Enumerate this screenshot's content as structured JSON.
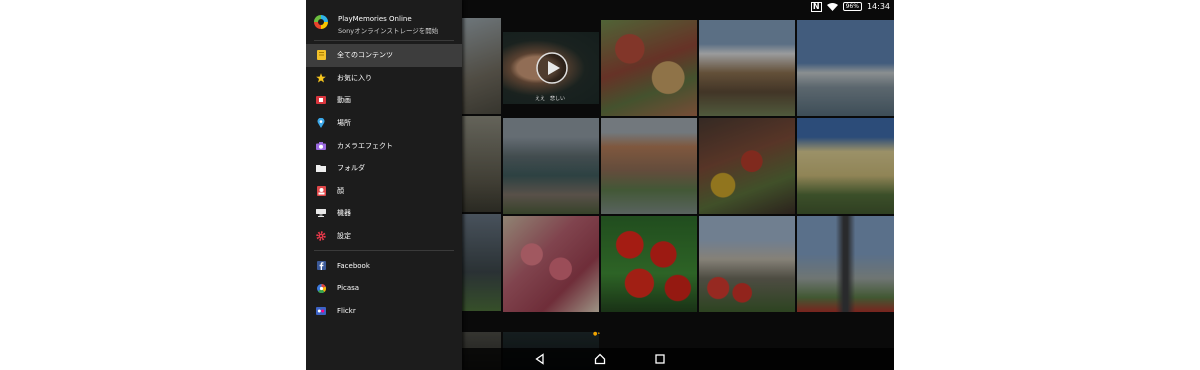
{
  "status_bar": {
    "nfc": "N",
    "battery": "96%",
    "time": "14:34"
  },
  "app": {
    "title": "PlayMemories Online",
    "subtitle": "Sonyオンラインストレージを開始"
  },
  "menu": [
    {
      "label": "全てのコンテンツ",
      "icon": "folder-yellow-icon",
      "active": true
    },
    {
      "label": "お気に入り",
      "icon": "star-icon"
    },
    {
      "label": "動画",
      "icon": "video-icon"
    },
    {
      "label": "場所",
      "icon": "location-pin-icon"
    },
    {
      "label": "カメラエフェクト",
      "icon": "camera-icon"
    },
    {
      "label": "フォルダ",
      "icon": "folder-icon"
    },
    {
      "label": "顔",
      "icon": "face-icon"
    },
    {
      "label": "機器",
      "icon": "device-icon"
    },
    {
      "label": "設定",
      "icon": "gear-icon"
    }
  ],
  "services": [
    {
      "label": "Facebook",
      "icon": "facebook-icon"
    },
    {
      "label": "Picasa",
      "icon": "picasa-icon"
    },
    {
      "label": "Flickr",
      "icon": "flickr-icon"
    }
  ],
  "video_caption": "ええ　悲しい",
  "colors": {
    "drawer_bg": "#1c1c1c",
    "active_bg": "#3d3d3d",
    "screen_bg": "#0a0a0a"
  }
}
